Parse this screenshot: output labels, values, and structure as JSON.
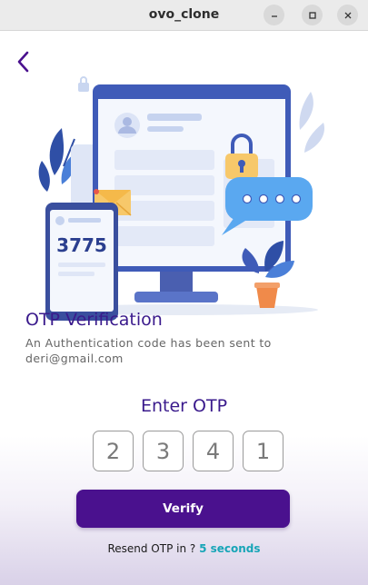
{
  "window": {
    "title": "ovo_clone"
  },
  "hero": {
    "phone_code": "3775"
  },
  "otp": {
    "title": "OTP Verification",
    "subtitle": "An Authentication code has been sent to deri@gmail.com",
    "enter_label": "Enter OTP",
    "digits": [
      "2",
      "3",
      "4",
      "1"
    ]
  },
  "actions": {
    "verify_label": "Verify"
  },
  "resend": {
    "label": "Resend OTP in ? ",
    "timer": "5 seconds"
  },
  "colors": {
    "primary": "#4a118e",
    "heading": "#3a1a8c",
    "timer": "#17a5b7",
    "illustration_blue": "#4a7fd8"
  },
  "icons": {
    "back": "chevron-left-icon",
    "minimize": "minimize-icon",
    "maximize": "maximize-icon",
    "close": "close-icon"
  }
}
